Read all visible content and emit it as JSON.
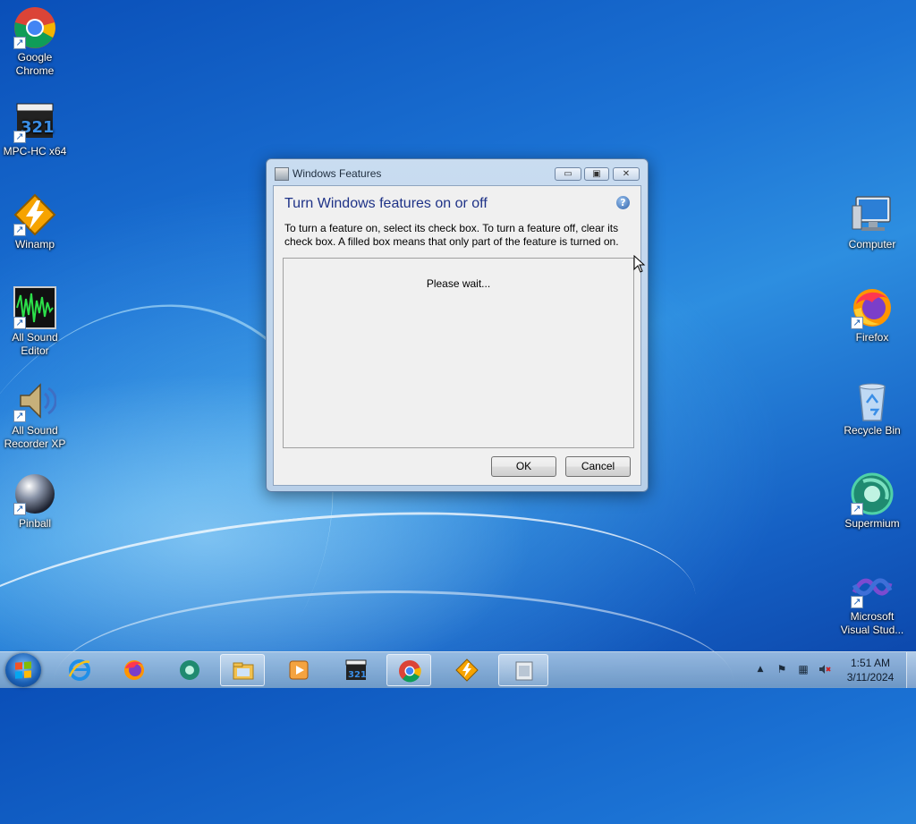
{
  "desktop": {
    "left_icons": [
      {
        "label": "Google Chrome",
        "icon": "chrome-icon"
      },
      {
        "label": "MPC-HC x64",
        "icon": "mpc-hc-icon"
      },
      {
        "label": "Winamp",
        "icon": "winamp-icon"
      },
      {
        "label": "All Sound Editor",
        "icon": "sound-editor-icon"
      },
      {
        "label": "All Sound Recorder XP",
        "icon": "sound-recorder-icon"
      },
      {
        "label": "Pinball",
        "icon": "pinball-icon"
      }
    ],
    "right_icons": [
      {
        "label": "Computer",
        "icon": "computer-icon"
      },
      {
        "label": "Firefox",
        "icon": "firefox-icon"
      },
      {
        "label": "Recycle Bin",
        "icon": "recycle-bin-icon"
      },
      {
        "label": "Supermium",
        "icon": "supermium-icon"
      },
      {
        "label": "Microsoft Visual Stud...",
        "icon": "visual-studio-icon"
      }
    ]
  },
  "dialog": {
    "title": "Windows Features",
    "heading": "Turn Windows features on or off",
    "description": "To turn a feature on, select its check box. To turn a feature off, clear its check box. A filled box means that only part of the feature is turned on.",
    "status": "Please wait...",
    "ok_label": "OK",
    "cancel_label": "Cancel",
    "help_glyph": "?",
    "minimize_glyph": "▭",
    "maximize_glyph": "▣",
    "close_glyph": "✕"
  },
  "taskbar": {
    "items": [
      {
        "name": "internet-explorer-icon"
      },
      {
        "name": "firefox-icon"
      },
      {
        "name": "supermium-icon"
      },
      {
        "name": "file-explorer-icon"
      },
      {
        "name": "media-player-icon"
      },
      {
        "name": "mpc-hc-icon"
      },
      {
        "name": "chrome-icon"
      },
      {
        "name": "winamp-icon"
      },
      {
        "name": "windows-features-icon"
      }
    ],
    "clock": {
      "time": "1:51 AM",
      "date": "3/11/2024"
    },
    "tray": {
      "chevron": "▲",
      "flag": "⚑",
      "network": "▦",
      "volume": "✕"
    }
  },
  "colors": {
    "heading_blue": "#1e3287",
    "desktop_blue": "#1b72d4"
  }
}
